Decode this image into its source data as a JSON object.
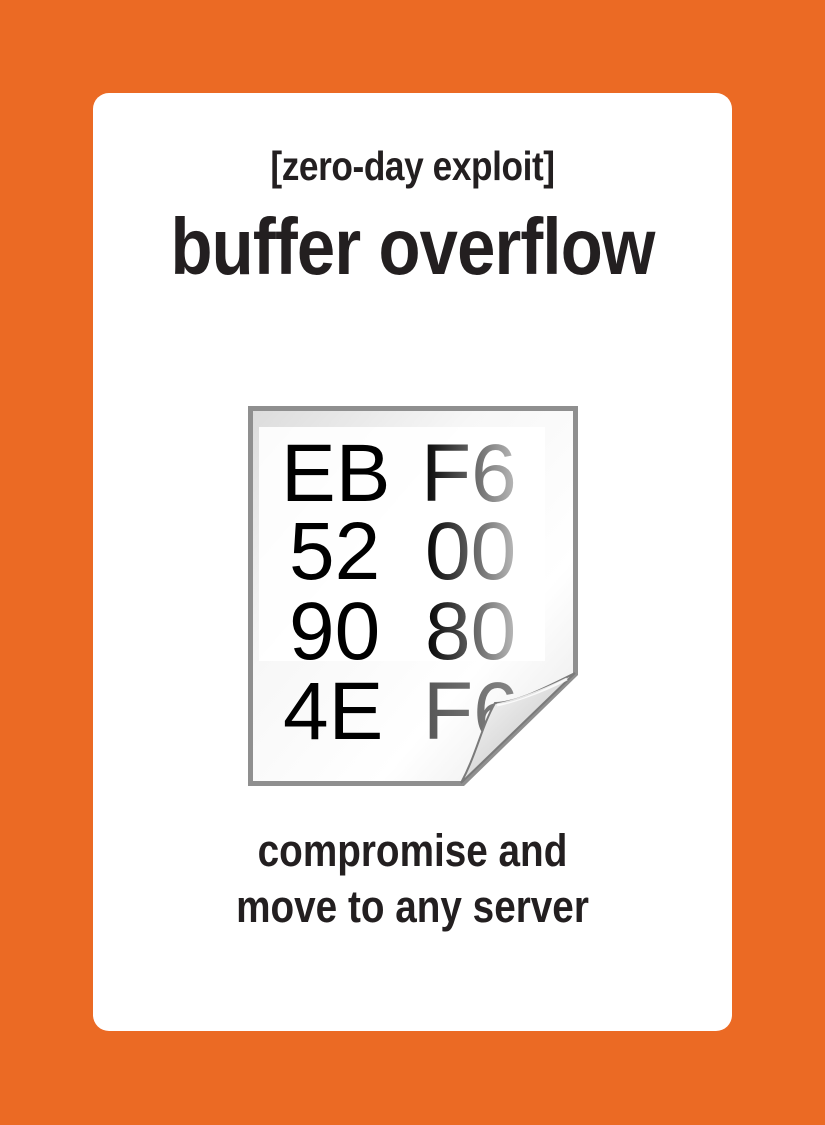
{
  "card": {
    "subtitle": "[zero-day exploit]",
    "title": "buffer overflow",
    "caption_line1": "compromise and",
    "caption_line2": "move to any server"
  },
  "hex_dump": {
    "row1": [
      "EB",
      "F6"
    ],
    "row2": [
      "52",
      "00"
    ],
    "row3": [
      "90",
      "80"
    ],
    "row4": [
      "4E",
      "F6"
    ]
  },
  "colors": {
    "background": "#EB6A24",
    "card": "#FFFFFF",
    "text": "#231F20",
    "hex_text": "#000000"
  },
  "icons": {
    "document": "curled-page-document-icon"
  }
}
